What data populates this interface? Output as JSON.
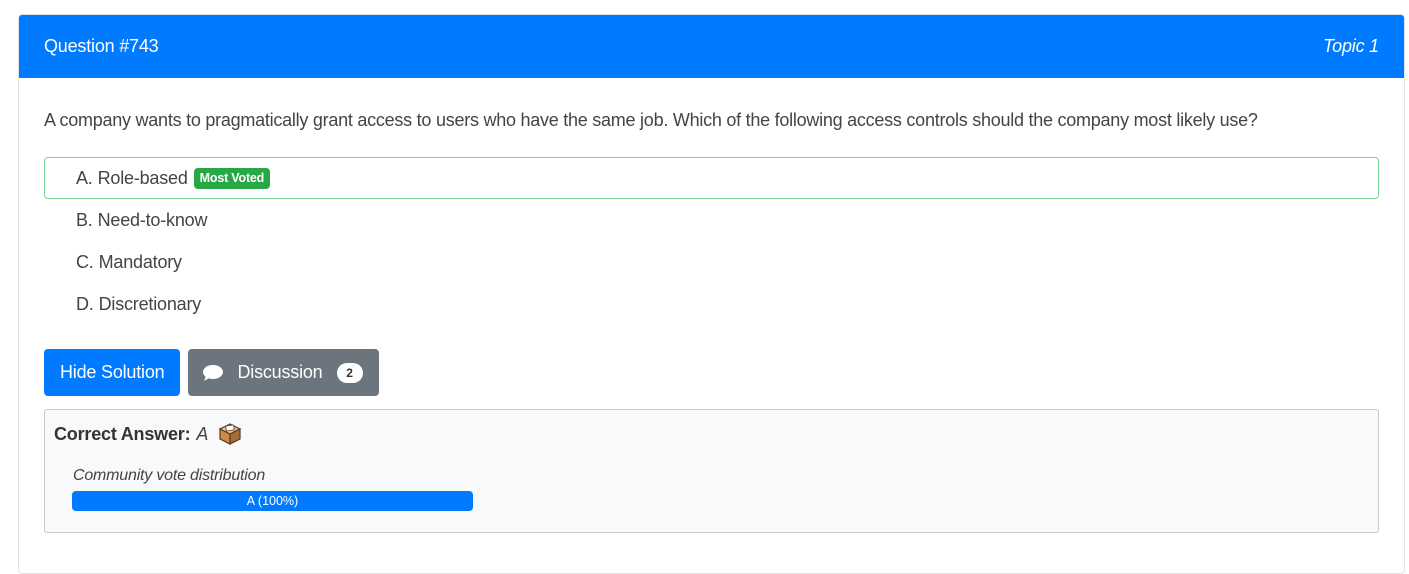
{
  "header": {
    "question_title": "Question #743",
    "topic": "Topic 1",
    "accent_color": "#007bff"
  },
  "question": {
    "text": "A company wants to pragmatically grant access to users who have the same job. Which of the following access controls should the company most likely use?"
  },
  "choices": [
    {
      "letter": "A.",
      "text": "Role-based",
      "badge": "Most Voted",
      "correct": true
    },
    {
      "letter": "B.",
      "text": "Need-to-know"
    },
    {
      "letter": "C.",
      "text": "Mandatory"
    },
    {
      "letter": "D.",
      "text": "Discretionary"
    }
  ],
  "buttons": {
    "hide_solution": "Hide Solution",
    "discussion": "Discussion",
    "discussion_count": "2",
    "discussion_icon": "speech-bubble-icon"
  },
  "answer": {
    "label": "Correct Answer:",
    "value": "A",
    "icon": "ballot-box-icon",
    "vote_title": "Community vote distribution",
    "vote_label": "A (100%)",
    "vote_percent": 100
  }
}
